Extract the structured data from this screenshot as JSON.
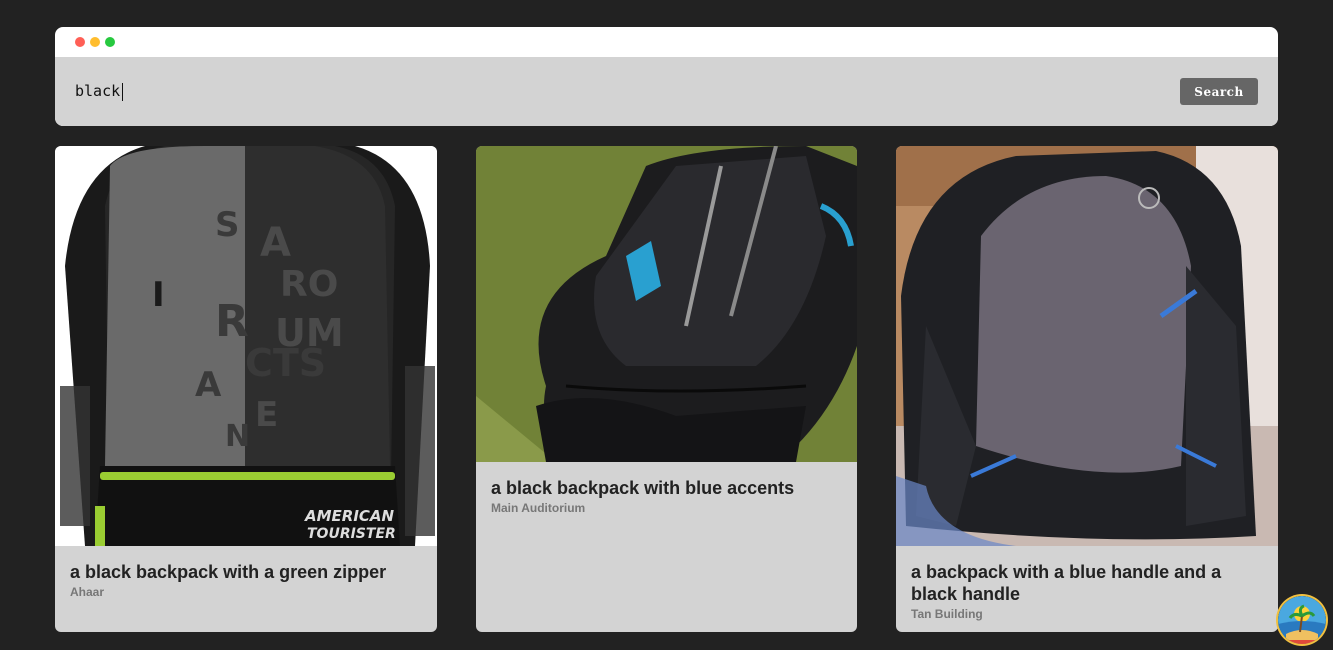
{
  "window": {
    "controls": [
      "close",
      "minimize",
      "maximize"
    ]
  },
  "search": {
    "value": "black",
    "button_label": "Search"
  },
  "results": [
    {
      "title": "a black backpack with a green zipper",
      "location": "Ahaar",
      "image": "black-gray-backpack-photo"
    },
    {
      "title": "a black backpack with blue accents",
      "location": "Main Auditorium",
      "image": "black-backpack-on-grass-photo"
    },
    {
      "title": "a backpack with a blue handle and a black handle",
      "location": "Tan Building",
      "image": "gray-black-backpack-photo"
    }
  ],
  "floating_button": {
    "icon": "beach-island-icon"
  },
  "colors": {
    "background": "#222222",
    "search_bar": "#d3d3d3",
    "card": "#d3d3d3",
    "button": "#666666"
  }
}
